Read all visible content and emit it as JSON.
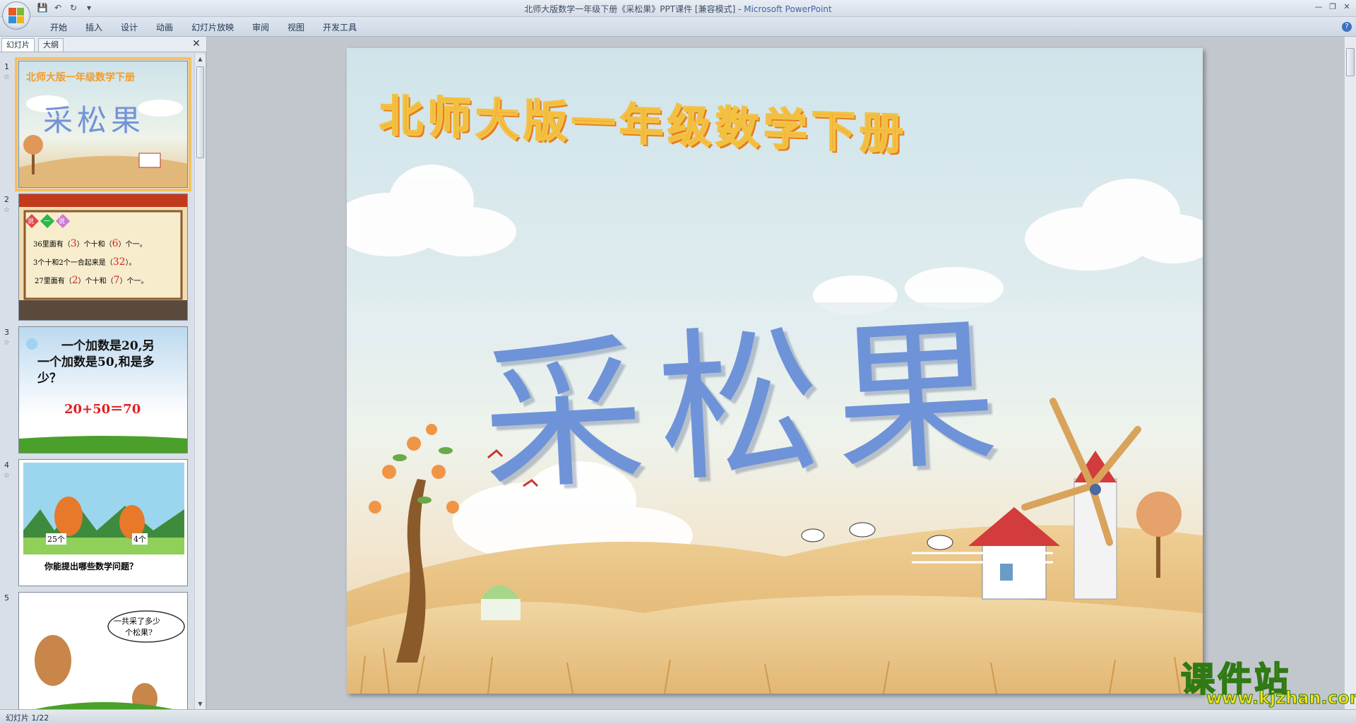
{
  "window": {
    "title_doc": "北师大版数学一年级下册《采松果》PPT课件 [兼容模式] - ",
    "title_app": "Microsoft PowerPoint"
  },
  "ribbon": {
    "tabs": [
      "开始",
      "插入",
      "设计",
      "动画",
      "幻灯片放映",
      "审阅",
      "视图",
      "开发工具"
    ]
  },
  "left_panel": {
    "tabs": [
      "幻灯片",
      "大纲"
    ],
    "active_tab": "幻灯片",
    "slides": [
      {
        "number": "1",
        "subtitle": "北师大版一年级数学下册",
        "title": "采松果"
      },
      {
        "number": "2",
        "badge": [
          "说",
          "一",
          "说"
        ],
        "lines": [
          {
            "pre": "36里面有（",
            "a": "3",
            "mid": "）个十和（",
            "b": "6",
            "post": "）个一。"
          },
          {
            "pre": "3个十和2个一合起来是（",
            "a": "32",
            "mid": "）。",
            "b": "",
            "post": ""
          },
          {
            "pre": "27里面有（",
            "a": "2",
            "mid": "）个十和（",
            "b": "7",
            "post": "）个一。"
          }
        ]
      },
      {
        "number": "3",
        "question_l1": "一个加数是20,另",
        "question_l2": "一个加数是50,和是多",
        "question_l3": "少？",
        "answer": "20+50＝70"
      },
      {
        "number": "4",
        "label_a": "25个",
        "label_b": "4个",
        "question": "你能提出哪些数学问题？"
      },
      {
        "number": "5",
        "bubble_l1": "一共采了多少",
        "bubble_l2": "个松果?"
      }
    ]
  },
  "slide": {
    "subtitle": "北师大版一年级数学下册",
    "title": "采松果"
  },
  "watermark": {
    "cn": "课件站",
    "url": "www.kjzhan.com"
  },
  "status": {
    "slide_indicator": "幻灯片 1/22"
  },
  "colors": {
    "ribbon_bg": "#d6dfea",
    "selection": "#f6c15a",
    "title_blue": "#6f93d8",
    "subtitle_orange": "#f7a23a"
  }
}
